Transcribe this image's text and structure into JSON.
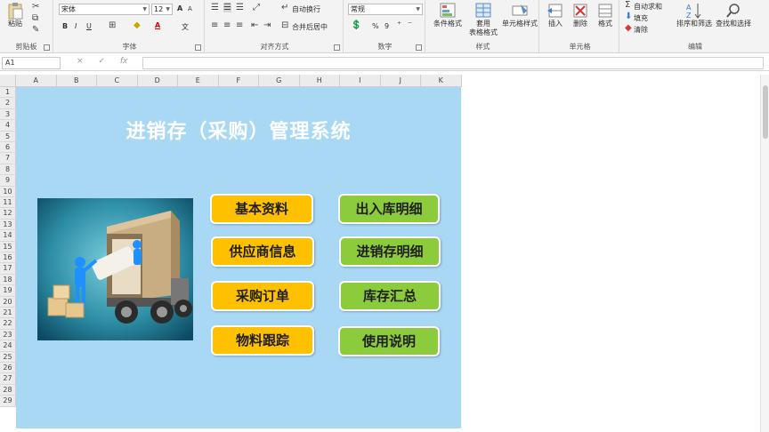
{
  "ribbon": {
    "clipboard": {
      "paste_label": "粘贴",
      "group_label": "剪贴板"
    },
    "font": {
      "font_name": "宋体",
      "font_size": "12",
      "bold": "B",
      "italic": "I",
      "underline": "U",
      "font_color_glyph": "A",
      "grow": "A",
      "shrink": "A",
      "wen": "文",
      "group_label": "字体"
    },
    "alignment": {
      "wrap_label": "自动换行",
      "merge_label": "合并后居中",
      "group_label": "对齐方式"
    },
    "number": {
      "format_value": "常规",
      "percent": "%",
      "comma": "9",
      "group_label": "数字"
    },
    "styles": {
      "cond_label": "条件格式",
      "table_label_1": "套用",
      "table_label_2": "表格格式",
      "cell_style_label": "单元格样式",
      "group_label": "样式"
    },
    "cells": {
      "insert_label": "插入",
      "delete_label": "删除",
      "format_label": "格式",
      "group_label": "单元格"
    },
    "editing": {
      "autosum_label": "自动求和",
      "fill_label": "填充",
      "clear_label": "清除",
      "sort_label": "排序和筛选",
      "find_label": "查找和选择",
      "group_label": "编辑"
    }
  },
  "formula_bar": {
    "cell_ref": "A1",
    "fx": "fx",
    "cancel": "×",
    "confirm": "✓",
    "value": ""
  },
  "grid": {
    "columns": [
      "A",
      "B",
      "C",
      "D",
      "E",
      "F",
      "G",
      "H",
      "I",
      "J",
      "K"
    ],
    "rows": [
      "1",
      "2",
      "3",
      "4",
      "5",
      "6",
      "7",
      "8",
      "9",
      "10",
      "11",
      "12",
      "13",
      "14",
      "15",
      "16",
      "17",
      "18",
      "19",
      "20",
      "21",
      "22",
      "23",
      "24",
      "25",
      "26",
      "27",
      "28",
      "29"
    ]
  },
  "dashboard": {
    "title": "进销存（采购）管理系统",
    "left_buttons": [
      "基本资料",
      "供应商信息",
      "采购订单",
      "物料跟踪"
    ],
    "right_buttons": [
      "出入库明细",
      "进销存明细",
      "库存汇总",
      "使用说明"
    ],
    "colors": {
      "panel": "#a9d8f5",
      "yellow": "#ffc000",
      "green": "#8ccc3c",
      "title": "#ffffff"
    }
  }
}
